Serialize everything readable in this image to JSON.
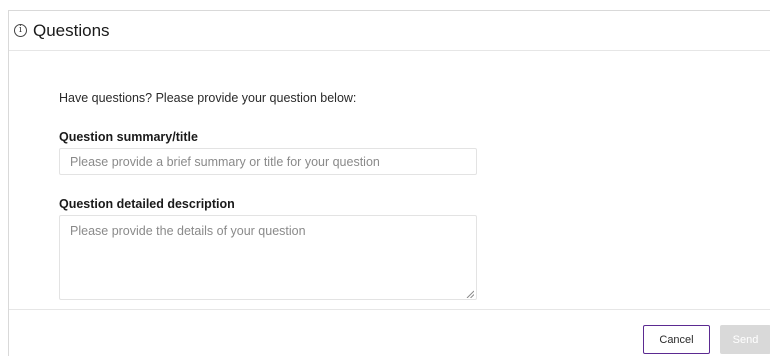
{
  "dialog": {
    "title": "Questions",
    "info_icon": "info-circle-icon"
  },
  "form": {
    "intro": "Have questions? Please provide your question below:",
    "summary": {
      "label": "Question summary/title",
      "placeholder": "Please provide a brief summary or title for your question",
      "value": ""
    },
    "description": {
      "label": "Question detailed description",
      "placeholder": "Please provide the details of your question",
      "value": ""
    }
  },
  "footer": {
    "cancel_label": "Cancel",
    "send_label": "Send",
    "send_disabled": true
  },
  "colors": {
    "accent": "#5b2a91",
    "disabled_button": "#d9d9d9"
  }
}
